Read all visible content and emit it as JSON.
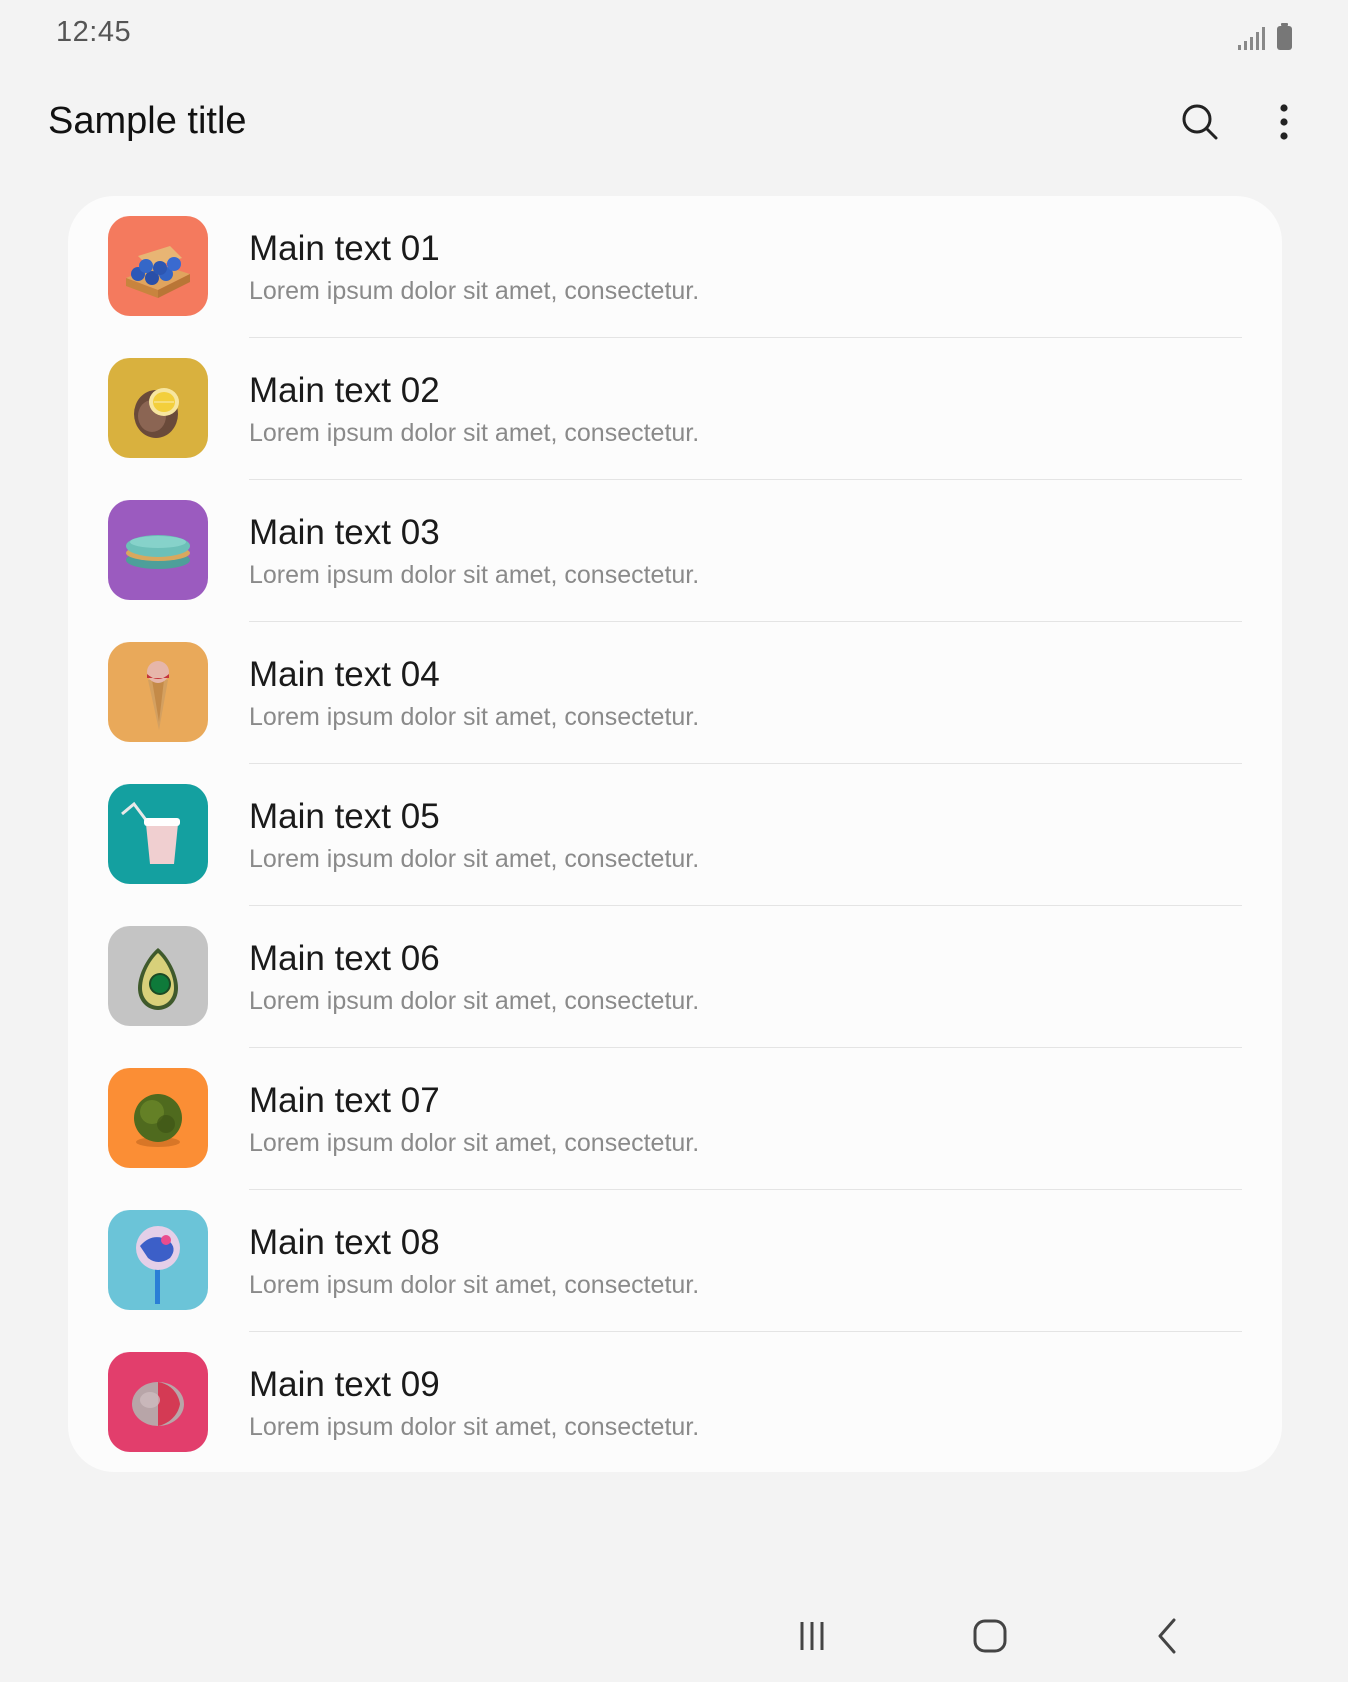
{
  "status_bar": {
    "time": "12:45",
    "icons": [
      "signal-icon",
      "battery-icon"
    ]
  },
  "app_bar": {
    "title": "Sample title",
    "actions": [
      "search-icon",
      "more-vert-icon"
    ]
  },
  "list": {
    "items": [
      {
        "main": "Main text 01",
        "sub": "Lorem ipsum dolor sit amet, consectetur.",
        "thumb_color": "#f47a5e",
        "thumb": "egg-carton"
      },
      {
        "main": "Main text 02",
        "sub": "Lorem ipsum dolor sit amet, consectetur.",
        "thumb_color": "#d9b13e",
        "thumb": "lemon"
      },
      {
        "main": "Main text 03",
        "sub": "Lorem ipsum dolor sit amet, consectetur.",
        "thumb_color": "#9b5bbf",
        "thumb": "macaron"
      },
      {
        "main": "Main text 04",
        "sub": "Lorem ipsum dolor sit amet, consectetur.",
        "thumb_color": "#e9a95a",
        "thumb": "ice-cream"
      },
      {
        "main": "Main text 05",
        "sub": "Lorem ipsum dolor sit amet, consectetur.",
        "thumb_color": "#14a0a0",
        "thumb": "cup"
      },
      {
        "main": "Main text 06",
        "sub": "Lorem ipsum dolor sit amet, consectetur.",
        "thumb_color": "#c4c4c4",
        "thumb": "avocado"
      },
      {
        "main": "Main text 07",
        "sub": "Lorem ipsum dolor sit amet, consectetur.",
        "thumb_color": "#fb8e35",
        "thumb": "moss-ball"
      },
      {
        "main": "Main text 08",
        "sub": "Lorem ipsum dolor sit amet, consectetur.",
        "thumb_color": "#6bc4d8",
        "thumb": "lollipop"
      },
      {
        "main": "Main text 09",
        "sub": "Lorem ipsum dolor sit amet, consectetur.",
        "thumb_color": "#e23e6c",
        "thumb": "stone"
      }
    ]
  },
  "nav_bar": {
    "buttons": [
      "recents-icon",
      "home-icon",
      "back-icon"
    ]
  }
}
